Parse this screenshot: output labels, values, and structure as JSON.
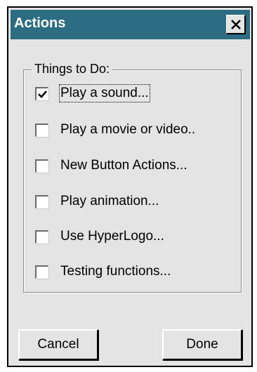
{
  "window": {
    "title": "Actions",
    "close_label": "X"
  },
  "group": {
    "label": "Things to Do:"
  },
  "checkboxes": [
    {
      "label": "Play a sound...",
      "checked": true
    },
    {
      "label": "Play a movie or video..",
      "checked": false
    },
    {
      "label": "New Button Actions...",
      "checked": false
    },
    {
      "label": "Play animation...",
      "checked": false
    },
    {
      "label": "Use HyperLogo...",
      "checked": false
    },
    {
      "label": "Testing functions...",
      "checked": false
    }
  ],
  "buttons": {
    "cancel_label": "Cancel",
    "done_label": "Done"
  },
  "colors": {
    "titlebar": "#2d6d84",
    "dialog_bg": "#e4e4e4"
  }
}
